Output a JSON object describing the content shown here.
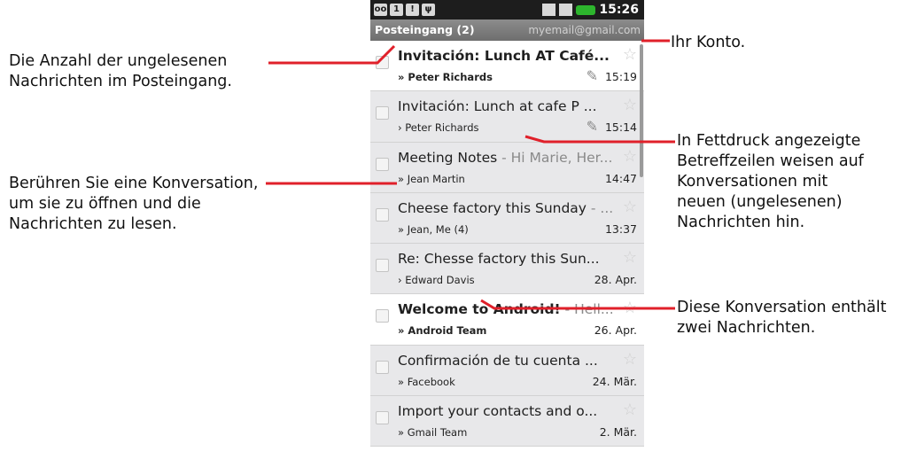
{
  "status_bar": {
    "icons": [
      "voicemail-icon",
      "calendar-icon",
      "warning-icon",
      "usb-icon"
    ],
    "right_icons": [
      "wifi-icon",
      "signal-icon",
      "battery-icon"
    ],
    "time": "15:26"
  },
  "header": {
    "inbox_label": "Posteingang (2)",
    "account": "myemail@gmail.com"
  },
  "conversations": [
    {
      "subject": "Invitación: Lunch AT Café...",
      "snippet": "",
      "from": "» Peter Richards",
      "date": "15:19",
      "unread": true,
      "attachment": true
    },
    {
      "subject": "Invitación: Lunch at cafe P ...",
      "snippet": "",
      "from": "› Peter Richards",
      "date": "15:14",
      "unread": false,
      "attachment": true
    },
    {
      "subject": "Meeting Notes",
      "snippet": " - Hi Marie, Her...",
      "from": "» Jean Martin",
      "date": "14:47",
      "unread": false,
      "attachment": false
    },
    {
      "subject": "Cheese factory this Sunday",
      "snippet": " - ...",
      "from": "» Jean, Me (4)",
      "date": "13:37",
      "unread": false,
      "attachment": false
    },
    {
      "subject": "Re: Chesse factory this Sun...",
      "snippet": "",
      "from": "› Edward Davis",
      "date": "28. Apr.",
      "unread": false,
      "attachment": false
    },
    {
      "subject": "Welcome to Android!",
      "snippet": " - Hell...",
      "from": "» Android Team",
      "date": "26. Apr.",
      "unread": true,
      "attachment": false
    },
    {
      "subject": "Confirmación de tu cuenta ...",
      "snippet": "",
      "from": "» Facebook",
      "date": "24. Mär.",
      "unread": false,
      "attachment": false
    },
    {
      "subject": "Import your contacts and o...",
      "snippet": "",
      "from": "» Gmail Team",
      "date": "2. Mär.",
      "unread": false,
      "attachment": false
    }
  ],
  "callouts": {
    "unread_count": "Die Anzahl der ungelesenen Nachrichten im Posteingang.",
    "touch_conversation": "Berühren Sie eine Konversation, um sie zu öffnen und die Nachrichten zu lesen.",
    "account": "Ihr Konto.",
    "bold_subjects": "In Fettdruck angezeigte Betreffzeilen weisen auf Konversationen mit neuen (ungelesenen) Nachrichten hin.",
    "two_messages": "Diese Konversation enthält zwei Nachrichten."
  },
  "colors": {
    "accent_line": "#e0202a",
    "header_bg": "#7d7d7d",
    "read_row": "#e8e8ea"
  }
}
